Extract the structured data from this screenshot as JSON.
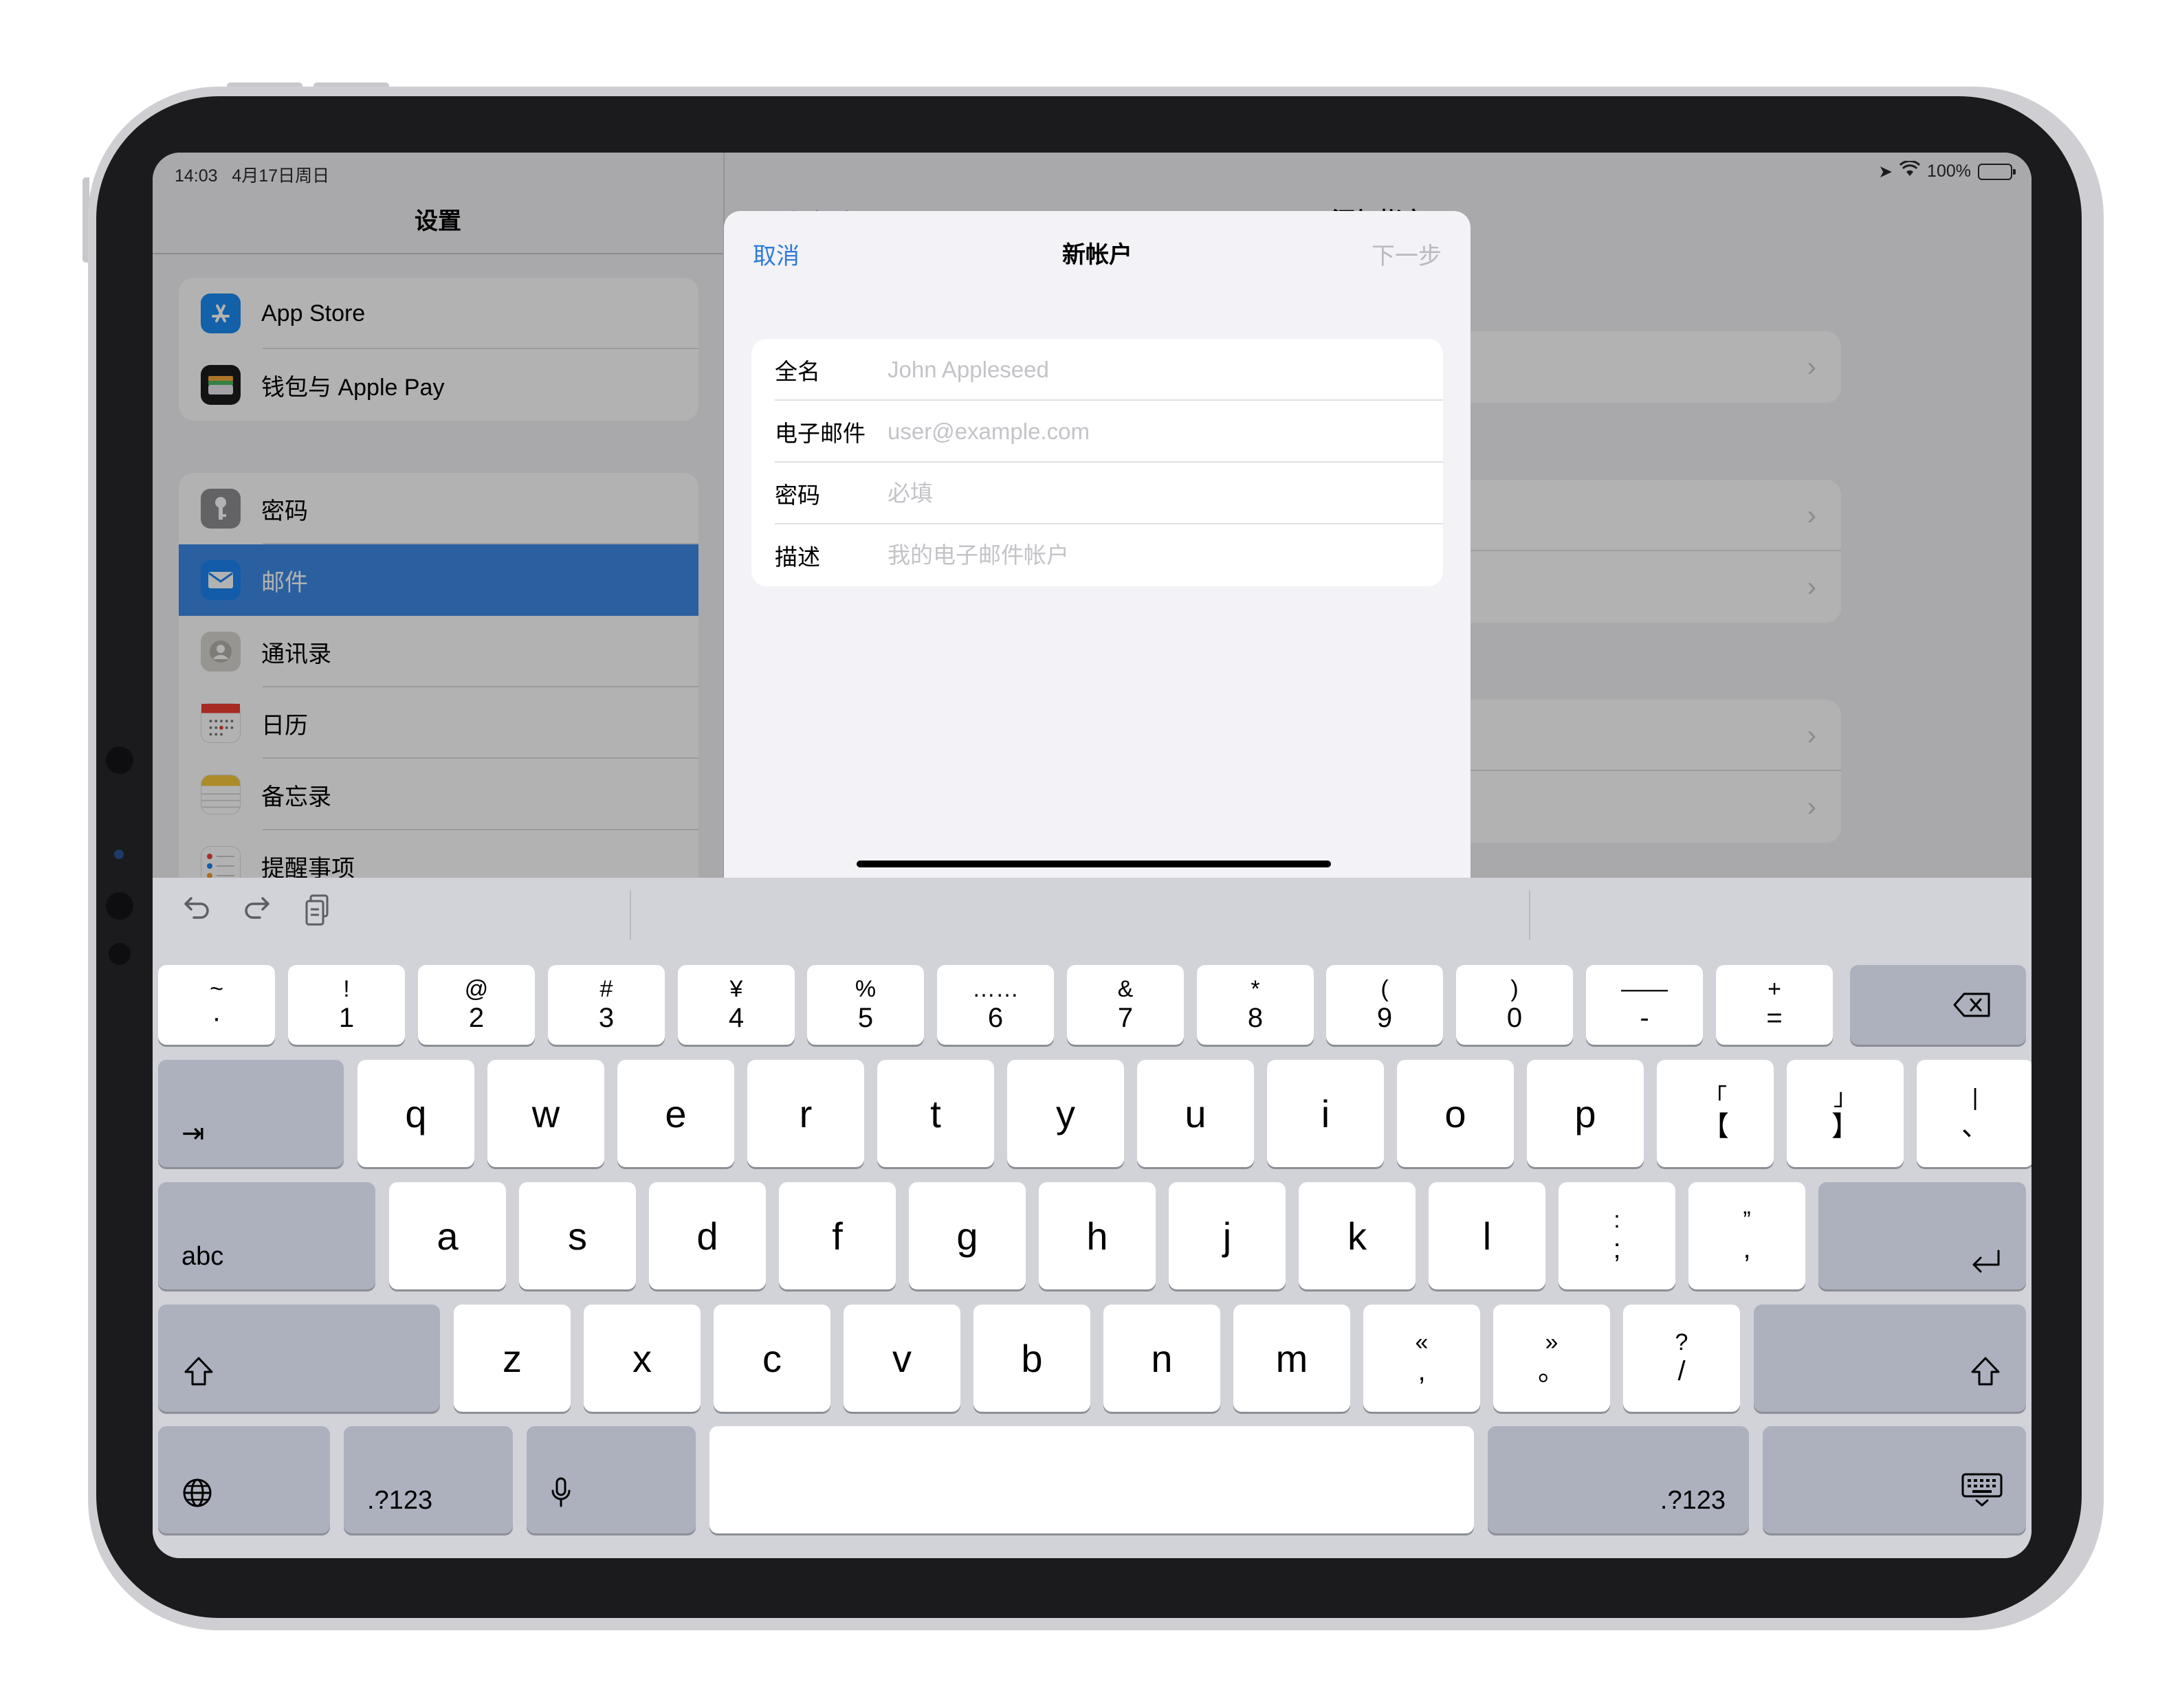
{
  "status": {
    "time": "14:03",
    "date": "4月17日周日",
    "battery": "100%"
  },
  "sidebar": {
    "title": "设置",
    "group1": [
      {
        "label": "App Store",
        "icon": "app-store-icon"
      },
      {
        "label": "钱包与 Apple Pay",
        "icon": "wallet-icon"
      }
    ],
    "group2": [
      {
        "label": "密码",
        "icon": "key-icon"
      },
      {
        "label": "邮件",
        "icon": "mail-icon",
        "selected": true
      },
      {
        "label": "通讯录",
        "icon": "contacts-icon"
      },
      {
        "label": "日历",
        "icon": "calendar-icon"
      },
      {
        "label": "备忘录",
        "icon": "notes-icon"
      },
      {
        "label": "提醒事项",
        "icon": "reminders-icon"
      }
    ]
  },
  "detail": {
    "back": "‹ 添加帐户",
    "title": "添加帐户"
  },
  "sheet": {
    "cancel": "取消",
    "title": "新帐户",
    "next": "下一步",
    "fields": [
      {
        "label": "全名",
        "placeholder": "John Appleseed"
      },
      {
        "label": "电子邮件",
        "placeholder": "user@example.com"
      },
      {
        "label": "密码",
        "placeholder": "必填"
      },
      {
        "label": "描述",
        "placeholder": "我的电子邮件帐户"
      }
    ]
  },
  "keyboard": {
    "row1": [
      [
        "~",
        "·"
      ],
      [
        "!",
        "1"
      ],
      [
        "@",
        "2"
      ],
      [
        "#",
        "3"
      ],
      [
        "¥",
        "4"
      ],
      [
        "%",
        "5"
      ],
      [
        "……",
        "6"
      ],
      [
        "&",
        "7"
      ],
      [
        "*",
        "8"
      ],
      [
        "(",
        "9"
      ],
      [
        ")",
        "0"
      ],
      [
        "——",
        "-"
      ],
      [
        "+",
        "="
      ]
    ],
    "row2": [
      "q",
      "w",
      "e",
      "r",
      "t",
      "y",
      "u",
      "i",
      "o",
      "p"
    ],
    "row2_extra": [
      [
        "「",
        "【"
      ],
      [
        "」",
        "】"
      ],
      [
        "|",
        "、"
      ]
    ],
    "row3": [
      "a",
      "s",
      "d",
      "f",
      "g",
      "h",
      "j",
      "k",
      "l"
    ],
    "row3_extra": [
      [
        ":",
        ";"
      ],
      [
        "”",
        ","
      ]
    ],
    "row4": [
      "z",
      "x",
      "c",
      "v",
      "b",
      "n",
      "m"
    ],
    "row4_extra": [
      [
        "«",
        ","
      ],
      [
        "»",
        "。"
      ],
      [
        "?",
        "/"
      ]
    ],
    "abc": "abc",
    "num_left": ".?123",
    "num_right": ".?123"
  }
}
